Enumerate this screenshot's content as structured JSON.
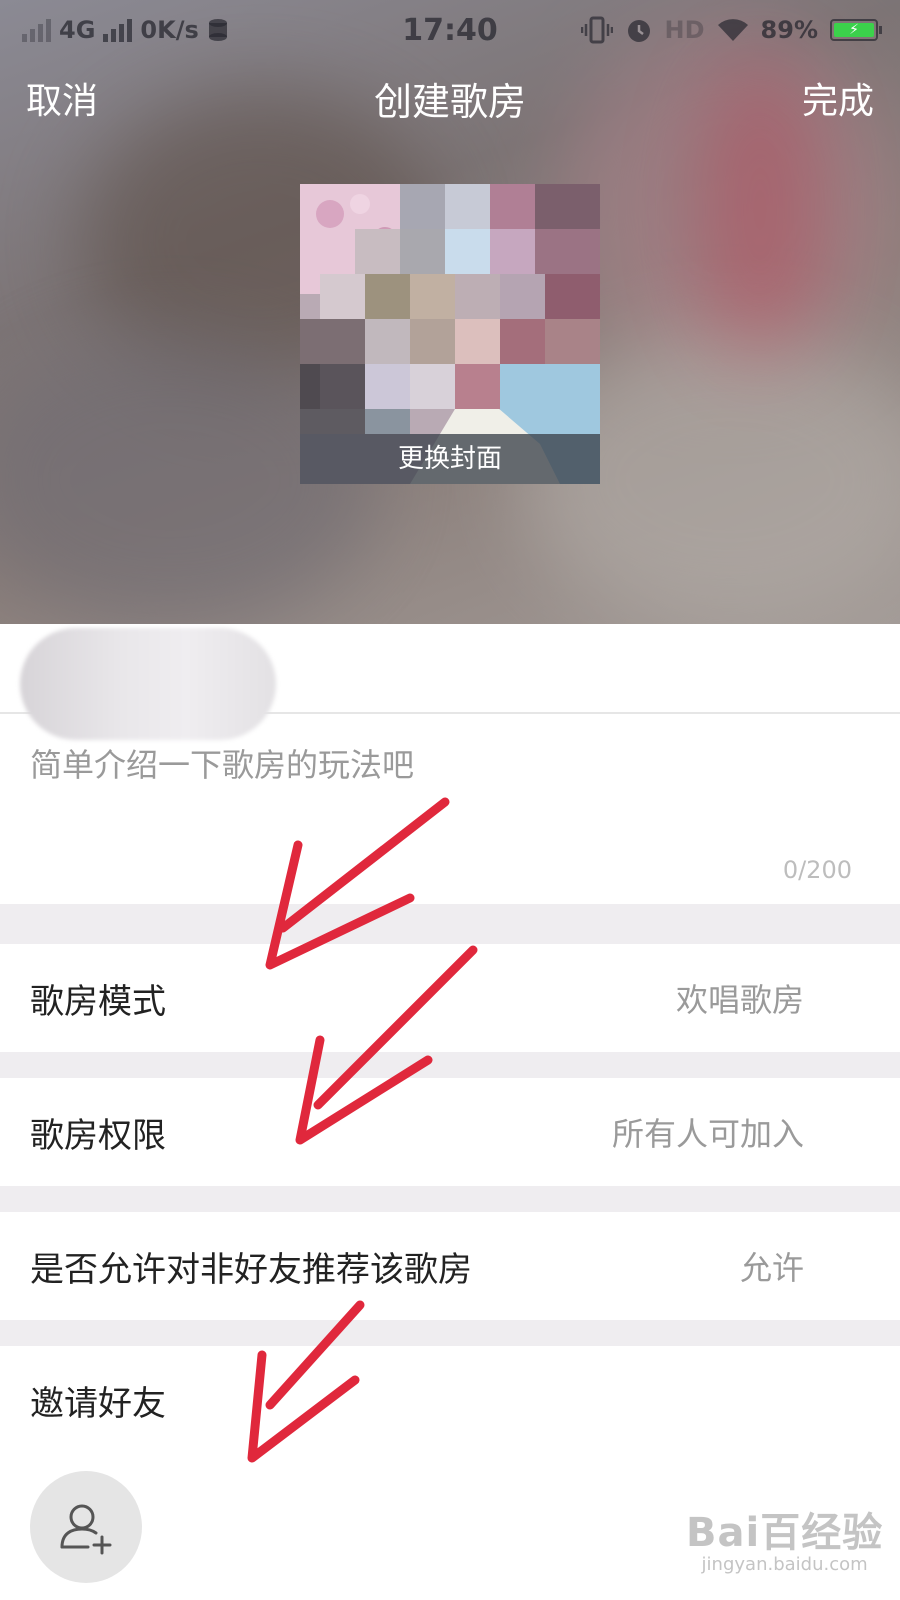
{
  "status_bar": {
    "network": "4G",
    "speed": "0K/s",
    "time": "17:40",
    "extra": "HD",
    "battery": "89%",
    "icons": [
      "signal-icon",
      "data-icon",
      "vibrate-icon",
      "alarm-icon",
      "wifi-icon",
      "battery-icon"
    ]
  },
  "nav": {
    "cancel": "取消",
    "title": "创建歌房",
    "done": "完成"
  },
  "cover": {
    "change_label": "更换封面"
  },
  "form": {
    "description_placeholder": "简单介绍一下歌房的玩法吧",
    "description_counter": "0/200"
  },
  "settings": [
    {
      "label": "歌房模式",
      "value": "欢唱歌房"
    },
    {
      "label": "歌房权限",
      "value": "所有人可加入"
    },
    {
      "label": "是否允许对非好友推荐该歌房",
      "value": "允许"
    }
  ],
  "invite": {
    "label": "邀请好友",
    "icon": "add-user-icon"
  },
  "watermark": {
    "logo": "Bai百经验",
    "url": "jingyan.baidu.com"
  },
  "colors": {
    "annotation_arrow": "#e0283c",
    "section_gap": "#efedf0",
    "secondary_text": "#9a9a9a"
  }
}
